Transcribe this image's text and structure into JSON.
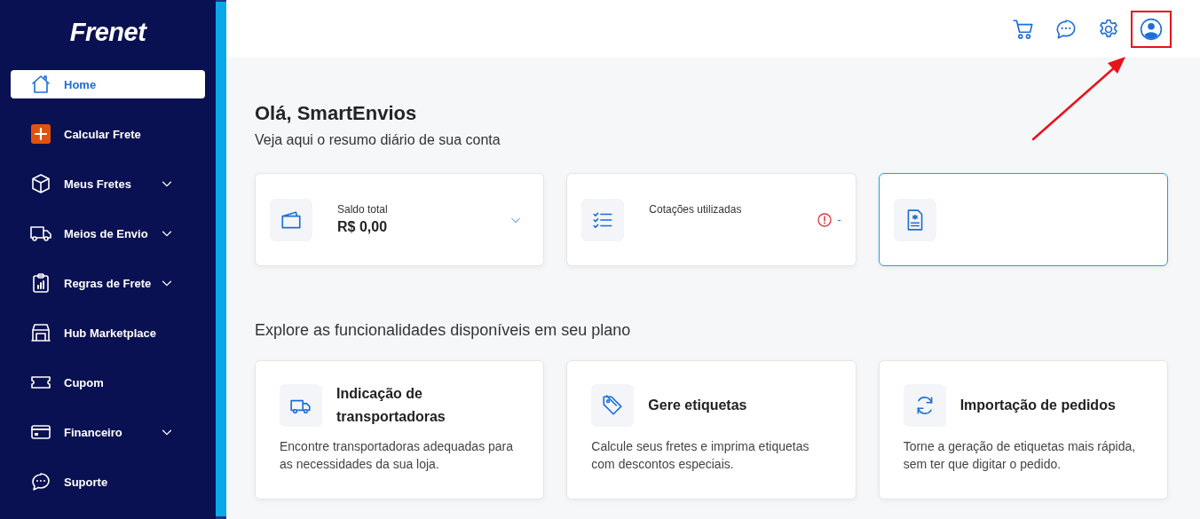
{
  "sidebar": {
    "logo": "Frenet",
    "items": [
      {
        "label": "Home",
        "selected": true,
        "expandable": false
      },
      {
        "label": "Calcular Frete",
        "selected": false,
        "expandable": false
      },
      {
        "label": "Meus Fretes",
        "selected": false,
        "expandable": true
      },
      {
        "label": "Meios de Envio",
        "selected": false,
        "expandable": true
      },
      {
        "label": "Regras de Frete",
        "selected": false,
        "expandable": true
      },
      {
        "label": "Hub Marketplace",
        "selected": false,
        "expandable": false
      },
      {
        "label": "Cupom",
        "selected": false,
        "expandable": false
      },
      {
        "label": "Financeiro",
        "selected": false,
        "expandable": true
      },
      {
        "label": "Suporte",
        "selected": false,
        "expandable": false
      }
    ]
  },
  "header": {
    "icons": [
      {
        "highlighted": false
      },
      {
        "highlighted": false
      },
      {
        "highlighted": false
      },
      {
        "highlighted": true
      }
    ]
  },
  "greeting": {
    "title": "Olá, SmartEnvios",
    "subtitle": "Veja aqui o resumo diário de sua conta"
  },
  "summary_cards": [
    {
      "kind": "balance",
      "label": "Saldo total",
      "value": "R$ 0,00",
      "selected": false
    },
    {
      "kind": "quotes",
      "label": "Cotações utilizadas",
      "value": "-",
      "selected": false
    },
    {
      "kind": "document",
      "selected": true
    }
  ],
  "features": {
    "heading": "Explore as funcionalidades disponíveis em seu plano",
    "cards": [
      {
        "title": "Indicação de transportadoras",
        "text": "Encontre transportadoras adequadas para as necessidades da sua loja."
      },
      {
        "title": "Gere etiquetas",
        "text": "Calcule seus fretes e imprima etiquetas com descontos especiais."
      },
      {
        "title": "Importação de pedidos",
        "text": "Torne a geração de etiquetas mais rápida, sem ter que digitar o pedido."
      }
    ]
  }
}
